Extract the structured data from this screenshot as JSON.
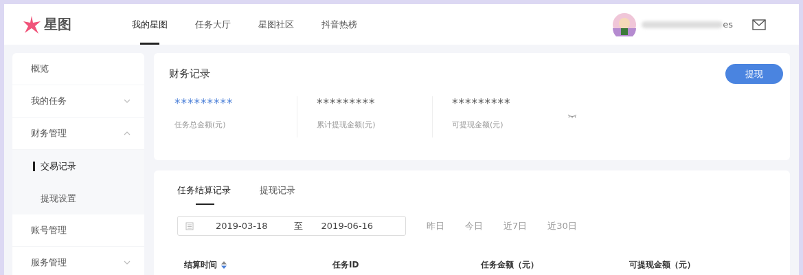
{
  "header": {
    "logo_text": "星图",
    "nav": [
      {
        "label": "我的星图",
        "selected": true
      },
      {
        "label": "任务大厅",
        "selected": false
      },
      {
        "label": "星图社区",
        "selected": false
      },
      {
        "label": "抖音热榜",
        "selected": false
      }
    ],
    "user": {
      "name_visible": "es"
    }
  },
  "sidebar": {
    "items": [
      {
        "label": "概览",
        "kind": "item",
        "selected": false
      },
      {
        "label": "我的任务",
        "kind": "group",
        "expanded": false,
        "selected": false
      },
      {
        "label": "财务管理",
        "kind": "group",
        "expanded": true,
        "selected": false,
        "children": [
          {
            "label": "交易记录",
            "selected": true
          },
          {
            "label": "提现设置",
            "selected": false
          }
        ]
      },
      {
        "label": "账号管理",
        "kind": "item",
        "selected": false
      },
      {
        "label": "服务管理",
        "kind": "group",
        "expanded": false,
        "selected": false
      }
    ]
  },
  "finance": {
    "title": "财务记录",
    "button": "提现",
    "stats": [
      {
        "value": "*********",
        "label": "任务总金额(元)",
        "highlight": true
      },
      {
        "value": "*********",
        "label": "累计提现金额(元)",
        "highlight": false
      },
      {
        "value": "*********",
        "label": "可提现金额(元)",
        "highlight": false
      }
    ]
  },
  "records": {
    "tabs": [
      {
        "label": "任务结算记录",
        "selected": true
      },
      {
        "label": "提现记录",
        "selected": false
      }
    ],
    "date_range": {
      "start": "2019-03-18",
      "separator": "至",
      "end": "2019-06-16"
    },
    "quick_ranges": [
      "昨日",
      "今日",
      "近7日",
      "近30日"
    ],
    "columns": [
      {
        "label": "结算时间",
        "sortable": true
      },
      {
        "label": "任务ID",
        "sortable": false
      },
      {
        "label": "任务金额（元）",
        "sortable": false
      },
      {
        "label": "可提现金额（元）",
        "sortable": false
      }
    ]
  }
}
